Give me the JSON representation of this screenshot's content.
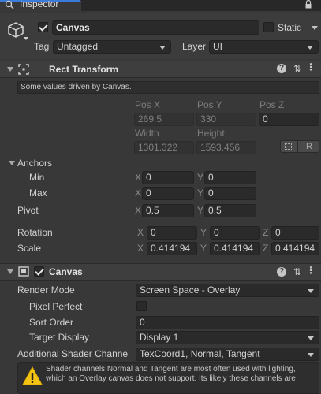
{
  "window": {
    "tab_title": "Inspector"
  },
  "gameobject": {
    "name": "Canvas",
    "active": true,
    "static_label": "Static",
    "tag_label": "Tag",
    "tag_value": "Untagged",
    "layer_label": "Layer",
    "layer_value": "UI"
  },
  "rect_transform": {
    "title": "Rect Transform",
    "note": "Some values driven by Canvas.",
    "pos_x_label": "Pos X",
    "pos_y_label": "Pos Y",
    "pos_z_label": "Pos Z",
    "pos_x": "269.5",
    "pos_y": "330",
    "pos_z": "0",
    "width_label": "Width",
    "height_label": "Height",
    "width": "1301.322",
    "height": "1593.456",
    "raw_button": "R",
    "anchors_label": "Anchors",
    "min_label": "Min",
    "max_label": "Max",
    "anchor_min_x": "0",
    "anchor_min_y": "0",
    "anchor_max_x": "0",
    "anchor_max_y": "0",
    "pivot_label": "Pivot",
    "pivot_x": "0.5",
    "pivot_y": "0.5",
    "rotation_label": "Rotation",
    "rot_x": "0",
    "rot_y": "0",
    "rot_z": "0",
    "scale_label": "Scale",
    "scale_x": "0.414194",
    "scale_y": "0.414194",
    "scale_z": "0.414194",
    "axis_x": "X",
    "axis_y": "Y",
    "axis_z": "Z"
  },
  "canvas": {
    "title": "Canvas",
    "enabled": true,
    "render_mode_label": "Render Mode",
    "render_mode_value": "Screen Space - Overlay",
    "pixel_perfect_label": "Pixel Perfect",
    "pixel_perfect": false,
    "sort_order_label": "Sort Order",
    "sort_order_value": "0",
    "target_display_label": "Target Display",
    "target_display_value": "Display 1",
    "shader_channels_label": "Additional Shader Channe",
    "shader_channels_value": "TexCoord1, Normal, Tangent",
    "warning_line1": "Shader channels Normal and Tangent are most often used with lighting,",
    "warning_line2": "which an Overlay canvas does not support. Its likely these channels are"
  }
}
